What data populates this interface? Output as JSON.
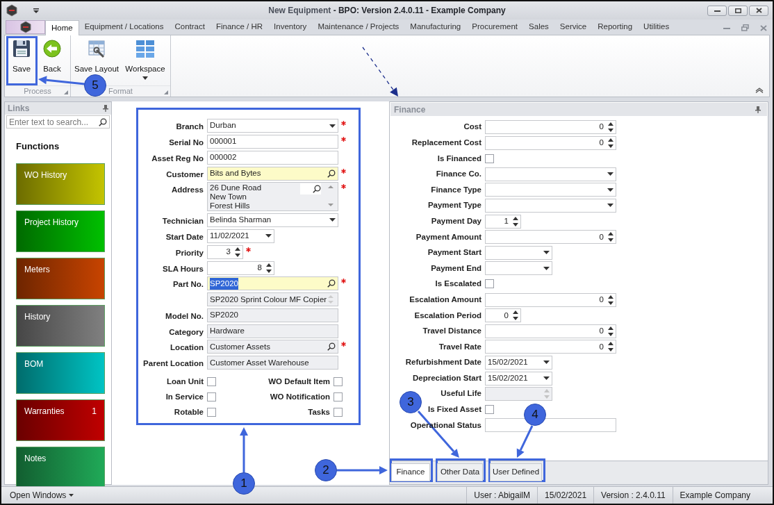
{
  "window": {
    "document": "New Equipment",
    "app": "- BPO: Version 2.4.0.11 - Example Company"
  },
  "ribbon_tabs": [
    {
      "label": "Home",
      "selected": true
    },
    {
      "label": "Equipment / Locations",
      "selected": false
    },
    {
      "label": "Contract",
      "selected": false
    },
    {
      "label": "Finance / HR",
      "selected": false
    },
    {
      "label": "Inventory",
      "selected": false
    },
    {
      "label": "Maintenance / Projects",
      "selected": false
    },
    {
      "label": "Manufacturing",
      "selected": false
    },
    {
      "label": "Procurement",
      "selected": false
    },
    {
      "label": "Sales",
      "selected": false
    },
    {
      "label": "Service",
      "selected": false
    },
    {
      "label": "Reporting",
      "selected": false
    },
    {
      "label": "Utilities",
      "selected": false
    }
  ],
  "ribbon_groups": [
    {
      "label": "Process",
      "buttons": [
        {
          "label": "Save",
          "kind": "save"
        },
        {
          "label": "Back",
          "kind": "back"
        }
      ]
    },
    {
      "label": "Format",
      "buttons": [
        {
          "label": "Save Layout",
          "kind": "layout"
        },
        {
          "label": "Workspace",
          "kind": "workspace"
        }
      ]
    }
  ],
  "links_panel": {
    "title": "Links",
    "search": {
      "placeholder": "Enter text to search..."
    },
    "heading": "Functions",
    "tiles": [
      {
        "label": "WO History",
        "color": "#c4c400"
      },
      {
        "label": "Project History",
        "color": "#00c000"
      },
      {
        "label": "Meters",
        "color": "#c84400"
      },
      {
        "label": "History",
        "color": "#808080"
      },
      {
        "label": "BOM",
        "color": "#00c4c4"
      },
      {
        "label": "Warranties",
        "count": "1",
        "color": "#c00000"
      },
      {
        "label": "Notes",
        "color": "#20aa58"
      }
    ]
  },
  "equipment_form": {
    "fields": [
      {
        "label": "Branch",
        "kind": "dropdown",
        "value": "Durban",
        "required": true
      },
      {
        "label": "Serial No",
        "kind": "text",
        "value": "000001",
        "required": true
      },
      {
        "label": "Asset Reg No",
        "kind": "text",
        "value": "000002",
        "required": false
      },
      {
        "label": "Customer",
        "kind": "lookup",
        "value": "Bits and Bytes",
        "required": true,
        "highlighted": true
      },
      {
        "label": "Address",
        "kind": "memo",
        "lines": [
          "26 Dune Road",
          "New Town",
          "Forest Hills"
        ],
        "required": true,
        "readonly": true,
        "searchable": true
      },
      {
        "label": "Technician",
        "kind": "dropdown",
        "value": "Belinda Sharman",
        "required": false
      },
      {
        "label": "Start Date",
        "kind": "date",
        "value": "11/02/2021",
        "required": false
      },
      {
        "label": "Priority",
        "kind": "spin-short",
        "value": "3",
        "required": true
      },
      {
        "label": "SLA Hours",
        "kind": "spin-medium",
        "value": "8",
        "required": false
      },
      {
        "label": "Part No.",
        "kind": "lookup",
        "value": "SP2020",
        "required": true,
        "highlighted": true,
        "value_selected": true
      },
      {
        "kind": "memo",
        "lines": [
          "SP2020 Sprint Colour MF Copier"
        ],
        "required": false,
        "readonly": true
      },
      {
        "label": "Model No.",
        "kind": "text",
        "value": "SP2020",
        "required": false,
        "readonly": true
      },
      {
        "label": "Category",
        "kind": "text",
        "value": "Hardware",
        "required": false,
        "readonly": true
      },
      {
        "label": "Location",
        "kind": "lookup",
        "value": "Customer Assets",
        "required": true,
        "readonly": true
      },
      {
        "label": "Parent Location",
        "kind": "text",
        "value": "Customer Asset Warehouse",
        "required": false,
        "readonly": true
      }
    ],
    "checkboxes": [
      {
        "label": "Loan Unit",
        "checked": false
      },
      {
        "label": "WO Default Item",
        "checked": false
      },
      {
        "label": "In Service",
        "checked": false
      },
      {
        "label": "WO Notification",
        "checked": false
      },
      {
        "label": "Rotable",
        "checked": false
      },
      {
        "label": "Tasks",
        "checked": false
      }
    ]
  },
  "finance_panel": {
    "title": "Finance",
    "fields": [
      {
        "label": "Cost",
        "kind": "spin",
        "value": "0"
      },
      {
        "label": "Replacement Cost",
        "kind": "spin",
        "value": "0"
      },
      {
        "label": "Is Financed",
        "kind": "checkbox",
        "checked": false
      },
      {
        "label": "Finance Co.",
        "kind": "dropdown"
      },
      {
        "label": "Finance Type",
        "kind": "dropdown"
      },
      {
        "label": "Payment Type",
        "kind": "dropdown"
      },
      {
        "label": "Payment Day",
        "kind": "spin-short",
        "value": "1"
      },
      {
        "label": "Payment Amount",
        "kind": "spin",
        "value": "0"
      },
      {
        "label": "Payment Start",
        "kind": "date"
      },
      {
        "label": "Payment End",
        "kind": "date"
      },
      {
        "label": "Is Escalated",
        "kind": "checkbox",
        "checked": false
      },
      {
        "label": "Escalation Amount",
        "kind": "spin",
        "value": "0"
      },
      {
        "label": "Escalation Period",
        "kind": "spin-short",
        "value": "0"
      },
      {
        "label": "Travel Distance",
        "kind": "spin",
        "value": "0"
      },
      {
        "label": "Travel Rate",
        "kind": "spin",
        "value": "0"
      },
      {
        "label": "Refurbishment Date",
        "kind": "date",
        "value": "15/02/2021"
      },
      {
        "label": "Depreciation Start",
        "kind": "date",
        "value": "15/02/2021"
      },
      {
        "label": "Useful Life",
        "kind": "spin-medium",
        "disabled": true
      },
      {
        "label": "Is Fixed Asset",
        "kind": "checkbox",
        "checked": false
      },
      {
        "label": "Operational Status",
        "kind": "text"
      }
    ],
    "tabs": [
      {
        "label": "Finance",
        "selected": true
      },
      {
        "label": "Other Data",
        "selected": false
      },
      {
        "label": "User Defined",
        "selected": false
      }
    ]
  },
  "status_bar": {
    "open_windows": "Open Windows",
    "items": [
      "User : AbigailM",
      "15/02/2021",
      "Version : 2.4.0.11",
      "Example Company"
    ]
  },
  "callouts": [
    {
      "number": "1"
    },
    {
      "number": "2"
    },
    {
      "number": "3"
    },
    {
      "number": "4"
    },
    {
      "number": "5"
    }
  ]
}
